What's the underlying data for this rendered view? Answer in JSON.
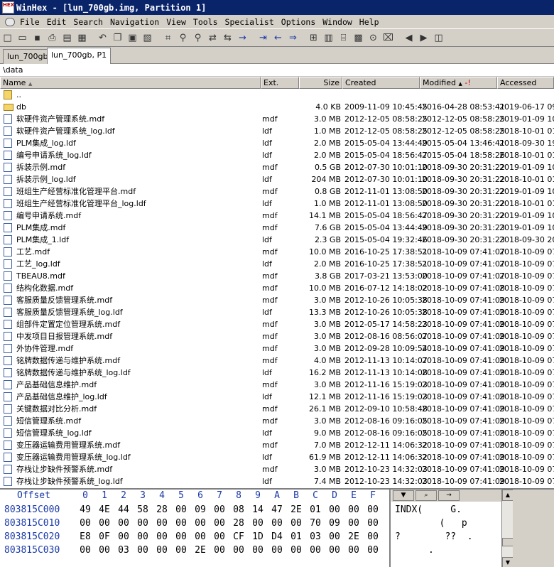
{
  "window": {
    "title": "WinHex - [lun_700gb.img, Partition 1]",
    "icon_text": "HEX"
  },
  "menu": [
    "File",
    "Edit",
    "Search",
    "Navigation",
    "View",
    "Tools",
    "Specialist",
    "Options",
    "Window",
    "Help"
  ],
  "toolbar": {
    "buttons": [
      "new-file-icon",
      "open-file-icon",
      "save-icon",
      "print-icon",
      "properties-icon",
      "page-setup-icon",
      "undo-icon",
      "copy-icon",
      "paste-icon",
      "paste-special-icon",
      "hex-convert-icon",
      "find-text-icon",
      "find-hex-icon",
      "replace-text-icon",
      "replace-hex-icon",
      "goto-offset-icon",
      "goto-sector-icon",
      "back-icon",
      "forward-icon",
      "disk-editor-icon",
      "ram-editor-icon",
      "drive-icon",
      "calculator-icon",
      "analyze-icon",
      "clear-icon",
      "prev-icon",
      "next-icon",
      "snapshot-icon"
    ]
  },
  "tabs": [
    {
      "label": "lun_700gb"
    },
    {
      "label": "lun_700gb, P1"
    }
  ],
  "path": "\\data",
  "columns": {
    "name": "Name",
    "ext": "Ext.",
    "size": "Size",
    "created": "Created",
    "modified": "Modified",
    "accessed": "Accessed"
  },
  "files": [
    {
      "name": "..",
      "ext": "",
      "size": "",
      "created": "",
      "modified": "",
      "accessed": "",
      "type": "parent"
    },
    {
      "name": "db",
      "ext": "",
      "size": "4.0 KB",
      "created": "2009-11-09  10:45:45",
      "modified": "2016-04-28  08:53:41",
      "accessed": "2019-06-17  09:5",
      "type": "folder"
    },
    {
      "name": "软硬件资产管理系统.mdf",
      "ext": "mdf",
      "size": "3.0 MB",
      "created": "2012-12-05  08:58:25",
      "modified": "2012-12-05  08:58:25",
      "accessed": "2019-01-09  10:3",
      "type": "file"
    },
    {
      "name": "软硬件资产管理系统_log.ldf",
      "ext": "ldf",
      "size": "1.0 MB",
      "created": "2012-12-05  08:58:25",
      "modified": "2012-12-05  08:58:25",
      "accessed": "2018-10-01  01:3",
      "type": "file"
    },
    {
      "name": "PLM集成_log.ldf",
      "ext": "ldf",
      "size": "2.0 MB",
      "created": "2015-05-04  13:44:49",
      "modified": "2015-05-04  13:46:41",
      "accessed": "2018-09-30  19:1",
      "type": "file"
    },
    {
      "name": "编号申请系统_log.ldf",
      "ext": "ldf",
      "size": "2.0 MB",
      "created": "2015-05-04  18:56:47",
      "modified": "2015-05-04  18:58:26",
      "accessed": "2018-10-01  01:3",
      "type": "file"
    },
    {
      "name": "拆装示例.mdf",
      "ext": "mdf",
      "size": "0.5 GB",
      "created": "2012-07-30  10:01:10",
      "modified": "2018-09-30  20:31:22",
      "accessed": "2019-01-09  10:3",
      "type": "file"
    },
    {
      "name": "拆装示例_log.ldf",
      "ext": "ldf",
      "size": "204 MB",
      "created": "2012-07-30  10:01:10",
      "modified": "2018-09-30  20:31:22",
      "accessed": "2018-10-01  01:3",
      "type": "file"
    },
    {
      "name": "班组生产经营标准化管理平台.mdf",
      "ext": "mdf",
      "size": "0.8 GB",
      "created": "2012-11-01  13:08:50",
      "modified": "2018-09-30  20:31:22",
      "accessed": "2019-01-09  10:3",
      "type": "file"
    },
    {
      "name": "班组生产经营标准化管理平台_log.ldf",
      "ext": "ldf",
      "size": "1.0 MB",
      "created": "2012-11-01  13:08:50",
      "modified": "2018-09-30  20:31:22",
      "accessed": "2018-10-01  01:3",
      "type": "file"
    },
    {
      "name": "编号申请系统.mdf",
      "ext": "mdf",
      "size": "14.1 MB",
      "created": "2015-05-04  18:56:47",
      "modified": "2018-09-30  20:31:22",
      "accessed": "2019-01-09  10:3",
      "type": "file"
    },
    {
      "name": "PLM集成.mdf",
      "ext": "mdf",
      "size": "7.6 GB",
      "created": "2015-05-04  13:44:49",
      "modified": "2018-09-30  20:31:23",
      "accessed": "2019-01-09  10:3",
      "type": "file"
    },
    {
      "name": "PLM集成_1.ldf",
      "ext": "ldf",
      "size": "2.3 GB",
      "created": "2015-05-04  19:32:46",
      "modified": "2018-09-30  20:31:23",
      "accessed": "2018-09-30  20:3",
      "type": "file"
    },
    {
      "name": "工艺.mdf",
      "ext": "mdf",
      "size": "10.0 MB",
      "created": "2016-10-25  17:38:51",
      "modified": "2018-10-09  07:41:07",
      "accessed": "2018-10-09  07:4",
      "type": "file"
    },
    {
      "name": "工艺_log.ldf",
      "ext": "ldf",
      "size": "2.0 MB",
      "created": "2016-10-25  17:38:51",
      "modified": "2018-10-09  07:41:07",
      "accessed": "2018-10-09  07:4",
      "type": "file"
    },
    {
      "name": "TBEAU8.mdf",
      "ext": "mdf",
      "size": "3.8 GB",
      "created": "2017-03-21  13:53:00",
      "modified": "2018-10-09  07:41:07",
      "accessed": "2018-10-09  07:4",
      "type": "file"
    },
    {
      "name": "结构化数据.mdf",
      "ext": "mdf",
      "size": "10.0 MB",
      "created": "2016-07-12  14:18:02",
      "modified": "2018-10-09  07:41:08",
      "accessed": "2018-10-09  07:4",
      "type": "file"
    },
    {
      "name": "客服质量反馈管理系统.mdf",
      "ext": "mdf",
      "size": "3.0 MB",
      "created": "2012-10-26  10:05:38",
      "modified": "2018-10-09  07:41:09",
      "accessed": "2018-10-09  07:4",
      "type": "file"
    },
    {
      "name": "客服质量反馈管理系统_log.ldf",
      "ext": "ldf",
      "size": "13.3 MB",
      "created": "2012-10-26  10:05:38",
      "modified": "2018-10-09  07:41:09",
      "accessed": "2018-10-09  07:4",
      "type": "file"
    },
    {
      "name": "组部件定置定位管理系统.mdf",
      "ext": "mdf",
      "size": "3.0 MB",
      "created": "2012-05-17  14:58:23",
      "modified": "2018-10-09  07:41:09",
      "accessed": "2018-10-09  07:4",
      "type": "file"
    },
    {
      "name": "中发项目日报管理系统.mdf",
      "ext": "mdf",
      "size": "3.0 MB",
      "created": "2012-08-16  08:56:07",
      "modified": "2018-10-09  07:41:09",
      "accessed": "2018-10-09  07:4",
      "type": "file"
    },
    {
      "name": "外协件管理.mdf",
      "ext": "mdf",
      "size": "3.0 MB",
      "created": "2012-09-28  10:09:54",
      "modified": "2018-10-09  07:41:09",
      "accessed": "2018-10-09  07:4",
      "type": "file"
    },
    {
      "name": "铭牌数据传递与维护系统.mdf",
      "ext": "mdf",
      "size": "4.0 MB",
      "created": "2012-11-13  10:14:07",
      "modified": "2018-10-09  07:41:09",
      "accessed": "2018-10-09  07:4",
      "type": "file"
    },
    {
      "name": "铭牌数据传递与维护系统_log.ldf",
      "ext": "ldf",
      "size": "16.2 MB",
      "created": "2012-11-13  10:14:08",
      "modified": "2018-10-09  07:41:09",
      "accessed": "2018-10-09  07:4",
      "type": "file"
    },
    {
      "name": "产品基础信息维护.mdf",
      "ext": "mdf",
      "size": "3.0 MB",
      "created": "2012-11-16  15:19:03",
      "modified": "2018-10-09  07:41:09",
      "accessed": "2018-10-09  07:4",
      "type": "file"
    },
    {
      "name": "产品基础信息维护_log.ldf",
      "ext": "ldf",
      "size": "12.1 MB",
      "created": "2012-11-16  15:19:03",
      "modified": "2018-10-09  07:41:09",
      "accessed": "2018-10-09  07:4",
      "type": "file"
    },
    {
      "name": "关键数据对比分析.mdf",
      "ext": "mdf",
      "size": "26.1 MB",
      "created": "2012-09-10  10:58:48",
      "modified": "2018-10-09  07:41:09",
      "accessed": "2018-10-09  07:4",
      "type": "file"
    },
    {
      "name": "短信管理系统.mdf",
      "ext": "mdf",
      "size": "3.0 MB",
      "created": "2012-08-16  09:16:05",
      "modified": "2018-10-09  07:41:09",
      "accessed": "2018-10-09  07:4",
      "type": "file"
    },
    {
      "name": "短信管理系统_log.ldf",
      "ext": "ldf",
      "size": "9.0 MB",
      "created": "2012-08-16  09:16:05",
      "modified": "2018-10-09  07:41:09",
      "accessed": "2018-10-09  07:4",
      "type": "file"
    },
    {
      "name": "变压器运输费用管理系统.mdf",
      "ext": "mdf",
      "size": "7.0 MB",
      "created": "2012-12-11  14:06:32",
      "modified": "2018-10-09  07:41:09",
      "accessed": "2018-10-09  07:4",
      "type": "file"
    },
    {
      "name": "变压器运输费用管理系统_log.ldf",
      "ext": "ldf",
      "size": "61.9 MB",
      "created": "2012-12-11  14:06:32",
      "modified": "2018-10-09  07:41:09",
      "accessed": "2018-10-09  07:4",
      "type": "file"
    },
    {
      "name": "存栈让步缺件预警系统.mdf",
      "ext": "mdf",
      "size": "3.0 MB",
      "created": "2012-10-23  14:32:03",
      "modified": "2018-10-09  07:41:09",
      "accessed": "2018-10-09  07:4",
      "type": "file"
    },
    {
      "name": "存栈让步缺件预警系统_log.ldf",
      "ext": "ldf",
      "size": "7.4 MB",
      "created": "2012-10-23  14:32:03",
      "modified": "2018-10-09  07:41:09",
      "accessed": "2018-10-09  07:4",
      "type": "file"
    }
  ],
  "hex": {
    "offset_label": "Offset",
    "columns": [
      "0",
      "1",
      "2",
      "3",
      "4",
      "5",
      "6",
      "7",
      "8",
      "9",
      "A",
      "B",
      "C",
      "D",
      "E",
      "F"
    ],
    "rows": [
      {
        "address": "803815C000",
        "bytes": [
          "49",
          "4E",
          "44",
          "58",
          "28",
          "00",
          "09",
          "00",
          "08",
          "14",
          "47",
          "2E",
          "01",
          "00",
          "00",
          "00"
        ],
        "ascii": "INDX(     G.    "
      },
      {
        "address": "803815C010",
        "bytes": [
          "00",
          "00",
          "00",
          "00",
          "00",
          "00",
          "00",
          "00",
          "28",
          "00",
          "00",
          "00",
          "70",
          "09",
          "00",
          "00"
        ],
        "ascii": "        (   p   "
      },
      {
        "address": "803815C020",
        "bytes": [
          "E8",
          "0F",
          "00",
          "00",
          "00",
          "00",
          "00",
          "00",
          "CF",
          "1D",
          "D4",
          "01",
          "03",
          "00",
          "2E",
          "00"
        ],
        "ascii": "?        ??  .  "
      },
      {
        "address": "803815C030",
        "bytes": [
          "00",
          "00",
          "03",
          "00",
          "00",
          "00",
          "2E",
          "00",
          "00",
          "00",
          "00",
          "00",
          "00",
          "00",
          "00",
          "00"
        ],
        "ascii": "      .         "
      }
    ]
  }
}
